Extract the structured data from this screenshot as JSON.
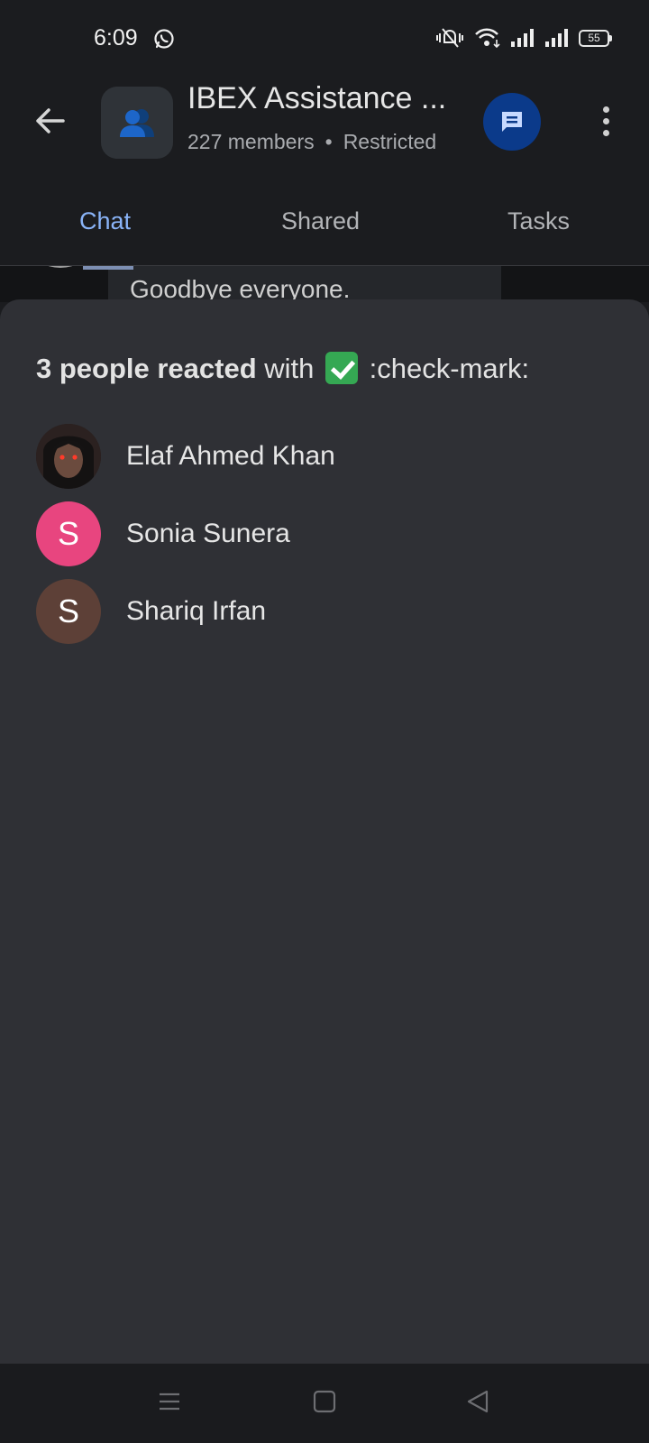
{
  "status_bar": {
    "time": "6:09",
    "battery": "55",
    "icons": [
      "whatsapp-icon",
      "mute-notification-icon",
      "wifi-icon",
      "signal-icon",
      "signal-icon",
      "battery-icon"
    ]
  },
  "header": {
    "title": "IBEX Assistance ...",
    "members": "227 members",
    "separator": "•",
    "access": "Restricted",
    "icons": [
      "back-arrow-icon",
      "group-icon",
      "chat-bubble-icon",
      "more-vert-icon"
    ]
  },
  "tabs": [
    {
      "label": "Chat",
      "active": true
    },
    {
      "label": "Shared",
      "active": false
    },
    {
      "label": "Tasks",
      "active": false
    }
  ],
  "chat_peek": {
    "message": "Goodbye everyone."
  },
  "reactions_sheet": {
    "count_text": "3 people reacted",
    "with_text": "with",
    "emoji_name": ":check-mark:",
    "people": [
      {
        "name": "Elaf Ahmed Khan",
        "initial": "",
        "avatar_color": "#3a2a26"
      },
      {
        "name": "Sonia Sunera",
        "initial": "S",
        "avatar_color": "#e8457f"
      },
      {
        "name": "Shariq Irfan",
        "initial": "S",
        "avatar_color": "#5d4037"
      }
    ]
  },
  "nav_bar": {
    "icons": [
      "recents-icon",
      "home-icon",
      "back-triangle-icon"
    ]
  },
  "colors": {
    "accent": "#8ab4f8",
    "sheet_bg": "#2f3035",
    "app_bg": "#1b1c1f"
  }
}
